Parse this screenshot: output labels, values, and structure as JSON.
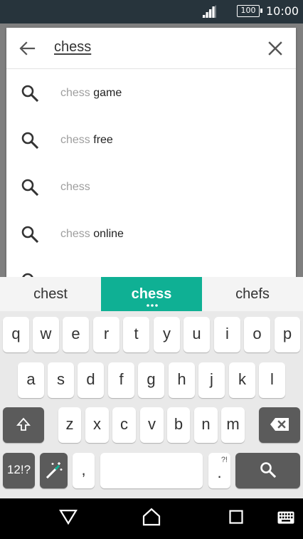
{
  "status_bar": {
    "battery": "100",
    "time": "10:00"
  },
  "search": {
    "query": "chess"
  },
  "suggestions": [
    {
      "query_part": "chess",
      "rest": " game"
    },
    {
      "query_part": "chess",
      "rest": " free"
    },
    {
      "query_part": "chess",
      "rest": ""
    },
    {
      "query_part": "chess",
      "rest": " online"
    }
  ],
  "keyboard": {
    "word_suggestions": [
      "chest",
      "chess",
      "chefs"
    ],
    "row1": [
      "q",
      "w",
      "e",
      "r",
      "t",
      "y",
      "u",
      "i",
      "o",
      "p"
    ],
    "row2": [
      "a",
      "s",
      "d",
      "f",
      "g",
      "h",
      "j",
      "k",
      "l"
    ],
    "row3": [
      "z",
      "x",
      "c",
      "v",
      "b",
      "n",
      "m"
    ],
    "symbols_key": "12!?",
    "comma_key": ",",
    "period_key": ".",
    "period_alt": "?!"
  }
}
